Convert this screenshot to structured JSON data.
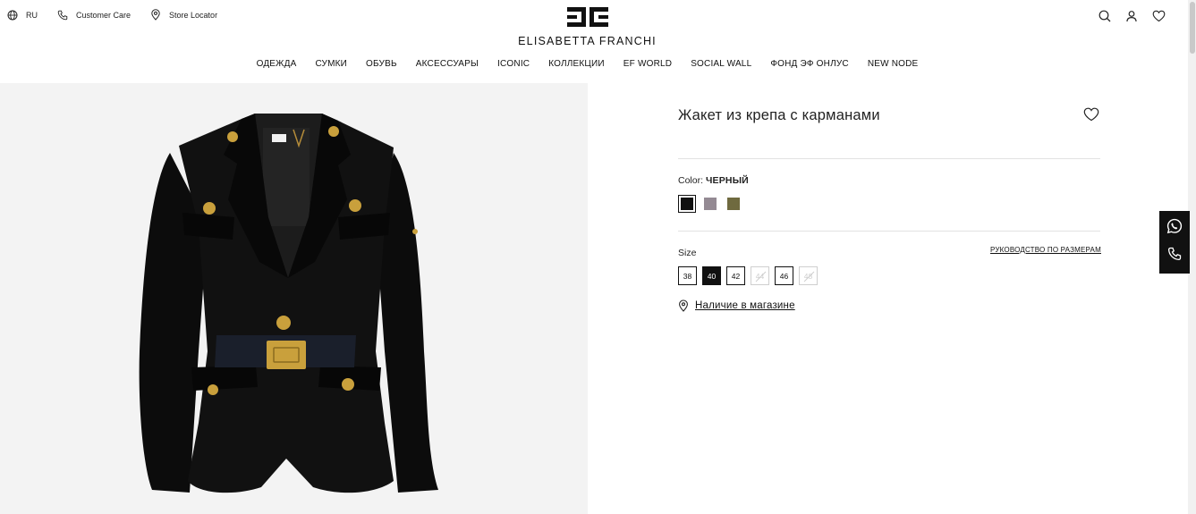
{
  "header": {
    "language": "RU",
    "customer_care": "Customer Care",
    "store_locator": "Store Locator",
    "brand": "ELISABETTA FRANCHI"
  },
  "nav": [
    "ОДЕЖДА",
    "СУМКИ",
    "ОБУВЬ",
    "АКСЕССУАРЫ",
    "ICONIC",
    "КОЛЛЕКЦИИ",
    "EF WORLD",
    "SOCIAL WALL",
    "ФОНД ЭФ ОНЛУС",
    "NEW NODE"
  ],
  "product": {
    "title": "Жакет из крепа с карманами",
    "color_label": "Color:",
    "color_value": "ЧЕРНЫЙ",
    "swatches": [
      {
        "name": "black",
        "color": "#111111",
        "selected": true
      },
      {
        "name": "grey-mauve",
        "color": "#948a93",
        "selected": false
      },
      {
        "name": "olive",
        "color": "#6f6a3f",
        "selected": false
      }
    ],
    "size_label": "Size",
    "size_guide": "РУКОВОДСТВО ПО РАЗМЕРАМ",
    "sizes": [
      {
        "label": "38",
        "state": "available"
      },
      {
        "label": "40",
        "state": "selected"
      },
      {
        "label": "42",
        "state": "available"
      },
      {
        "label": "44",
        "state": "unavailable"
      },
      {
        "label": "46",
        "state": "available"
      },
      {
        "label": "48",
        "state": "unavailable"
      }
    ],
    "store_availability": "Наличие в магазине"
  },
  "icons": {
    "header_right": [
      "search-icon",
      "account-icon",
      "wishlist-heart-icon"
    ],
    "side_widget": [
      "whatsapp-icon",
      "phone-icon"
    ]
  }
}
